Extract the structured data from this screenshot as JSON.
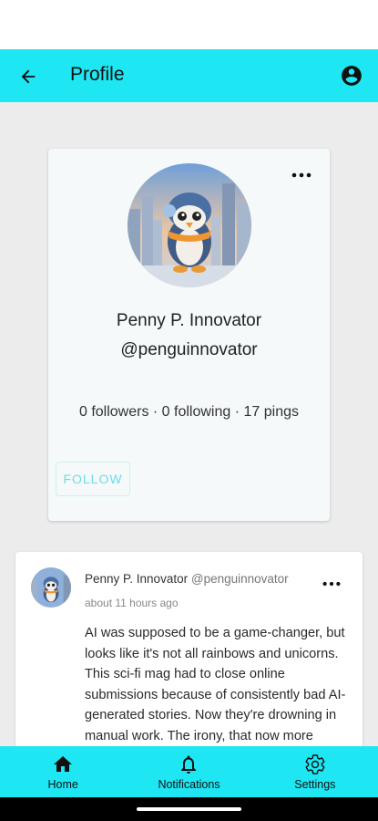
{
  "appbar": {
    "title": "Profile",
    "back_icon": "arrow-left-icon",
    "account_icon": "account-circle-icon",
    "background": "#1ee6f2"
  },
  "profile": {
    "display_name": "Penny P. Innovator",
    "handle": "@penguinnovator",
    "stats": "0 followers · 0 following · 17 pings",
    "follow_label": "FOLLOW",
    "more_icon": "more-horizontal-icon"
  },
  "post": {
    "author_name": "Penny P. Innovator",
    "author_handle": "@penguinnovator",
    "time": "about 11 hours ago",
    "body": "AI was supposed to be a game-changer, but looks like it's not all rainbows and unicorns. This sci-fi mag had to close online submissions because of consistently bad AI-generated stories. Now they're drowning in manual work. The irony, that now more humans!",
    "more_icon": "more-horizontal-icon"
  },
  "bottom_nav": {
    "items": [
      {
        "label": "Home",
        "icon": "home-icon"
      },
      {
        "label": "Notifications",
        "icon": "bell-icon"
      },
      {
        "label": "Settings",
        "icon": "gear-icon"
      }
    ]
  },
  "colors": {
    "accent": "#1ee6f2",
    "follow_text": "#6fdbe6"
  }
}
